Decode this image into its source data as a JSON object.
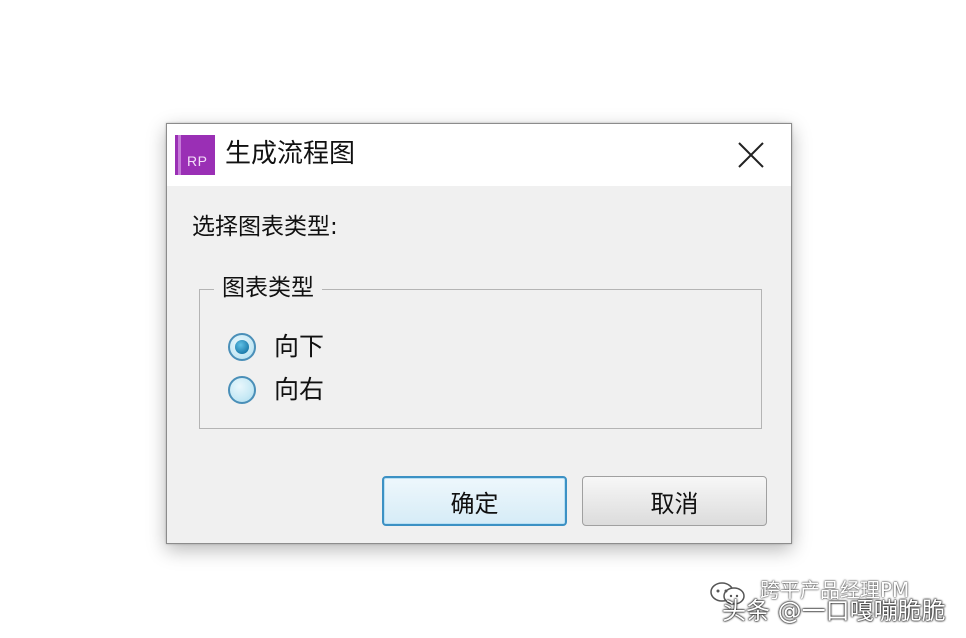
{
  "dialog": {
    "title": "生成流程图",
    "app_icon": {
      "text": "RP",
      "color": "#9a2fb5"
    },
    "close_icon": "close-icon",
    "prompt": "选择图表类型:",
    "group": {
      "legend": "图表类型",
      "options": [
        {
          "label": "向下",
          "checked": true
        },
        {
          "label": "向右",
          "checked": false
        }
      ]
    },
    "buttons": {
      "ok_label": "确定",
      "cancel_label": "取消"
    }
  },
  "watermark": {
    "line1": "跨平产品经理PM",
    "line2": "头条 @一口嘎嘣脆脆"
  },
  "colors": {
    "accent": "#3c91c4",
    "dialog_bg": "#f0f0f0",
    "titlebar_bg": "#ffffff"
  }
}
